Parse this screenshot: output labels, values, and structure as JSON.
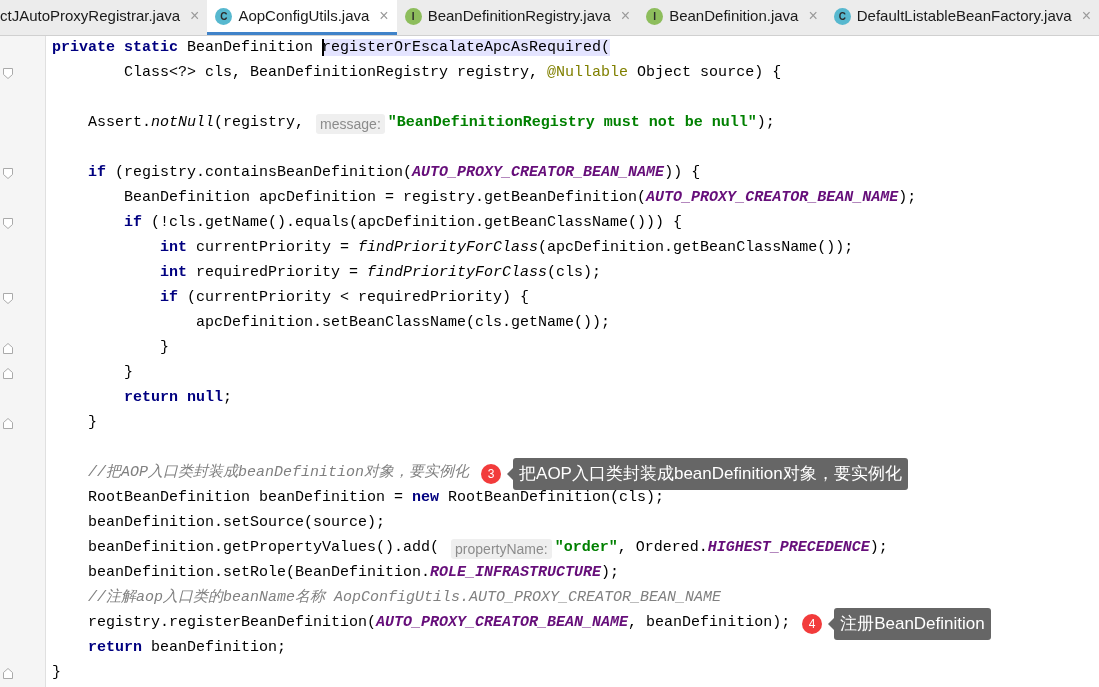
{
  "tabs": [
    {
      "label": "ctJAutoProxyRegistrar.java",
      "kind": "plain",
      "selected": false
    },
    {
      "label": "AopConfigUtils.java",
      "badge": "C",
      "kind": "class",
      "selected": true
    },
    {
      "label": "BeanDefinitionRegistry.java",
      "badge": "I",
      "kind": "interface",
      "selected": false
    },
    {
      "label": "BeanDefinition.java",
      "badge": "I",
      "kind": "interface",
      "selected": false
    },
    {
      "label": "DefaultListableBeanFactory.java",
      "badge": "C",
      "kind": "class",
      "selected": false
    }
  ],
  "close_glyph": "×",
  "code_lines": [
    {
      "kind": "code",
      "tokens": [
        {
          "kind": "keyword",
          "text": "private"
        },
        {
          "kind": "keyword",
          "text": " static"
        },
        {
          "kind": "plain",
          "text": " BeanDefinition "
        },
        {
          "kind": "selection",
          "text": "registerOrEscalateApcAsRequired("
        }
      ]
    },
    {
      "kind": "fold_start",
      "tokens": [
        {
          "kind": "plain",
          "text": "        Class<?> cls, BeanDefinitionRegistry registry, "
        },
        {
          "kind": "annotation",
          "text": "@Nullable"
        },
        {
          "kind": "plain",
          "text": " Object source) {"
        }
      ]
    },
    {
      "kind": "blank"
    },
    {
      "kind": "code",
      "tokens": [
        {
          "kind": "plain",
          "text": "    Assert."
        },
        {
          "kind": "italic",
          "text": "notNull"
        },
        {
          "kind": "plain",
          "text": "(registry, "
        },
        {
          "kind": "hint",
          "text": "message:"
        },
        {
          "kind": "string",
          "text": "\"BeanDefinitionRegistry must not be null\""
        },
        {
          "kind": "plain",
          "text": ");"
        }
      ]
    },
    {
      "kind": "blank"
    },
    {
      "kind": "fold_start",
      "tokens": [
        {
          "kind": "keyword",
          "text": "    if"
        },
        {
          "kind": "plain",
          "text": " (registry.containsBeanDefinition("
        },
        {
          "kind": "constant",
          "text": "AUTO_PROXY_CREATOR_BEAN_NAME"
        },
        {
          "kind": "plain",
          "text": ")) {"
        }
      ]
    },
    {
      "kind": "code",
      "tokens": [
        {
          "kind": "plain",
          "text": "        BeanDefinition apcDefinition = registry.getBeanDefinition("
        },
        {
          "kind": "constant",
          "text": "AUTO_PROXY_CREATOR_BEAN_NAME"
        },
        {
          "kind": "plain",
          "text": ");"
        }
      ]
    },
    {
      "kind": "fold_start",
      "tokens": [
        {
          "kind": "keyword",
          "text": "        if"
        },
        {
          "kind": "plain",
          "text": " (!cls.getName().equals(apcDefinition.getBeanClassName())) {"
        }
      ]
    },
    {
      "kind": "code",
      "tokens": [
        {
          "kind": "keyword",
          "text": "            int"
        },
        {
          "kind": "plain",
          "text": " currentPriority = "
        },
        {
          "kind": "italic",
          "text": "findPriorityForClass"
        },
        {
          "kind": "plain",
          "text": "(apcDefinition.getBeanClassName());"
        }
      ]
    },
    {
      "kind": "code",
      "tokens": [
        {
          "kind": "keyword",
          "text": "            int"
        },
        {
          "kind": "plain",
          "text": " requiredPriority = "
        },
        {
          "kind": "italic",
          "text": "findPriorityForClass"
        },
        {
          "kind": "plain",
          "text": "(cls);"
        }
      ]
    },
    {
      "kind": "fold_start",
      "tokens": [
        {
          "kind": "keyword",
          "text": "            if"
        },
        {
          "kind": "plain",
          "text": " (currentPriority < requiredPriority) {"
        }
      ]
    },
    {
      "kind": "code",
      "tokens": [
        {
          "kind": "plain",
          "text": "                apcDefinition.setBeanClassName(cls.getName());"
        }
      ]
    },
    {
      "kind": "fold_end",
      "tokens": [
        {
          "kind": "plain",
          "text": "            }"
        }
      ]
    },
    {
      "kind": "fold_end",
      "tokens": [
        {
          "kind": "plain",
          "text": "        }"
        }
      ]
    },
    {
      "kind": "code",
      "tokens": [
        {
          "kind": "keyword",
          "text": "        return"
        },
        {
          "kind": "keyword",
          "text": " null"
        },
        {
          "kind": "plain",
          "text": ";"
        }
      ]
    },
    {
      "kind": "fold_end",
      "tokens": [
        {
          "kind": "plain",
          "text": "    }"
        }
      ]
    },
    {
      "kind": "blank"
    },
    {
      "kind": "code",
      "tokens": [
        {
          "kind": "comment",
          "text": "    //把AOP入口类封装成beanDefinition对象，要实例化"
        }
      ],
      "callout": {
        "number": "3",
        "text": "把AOP入口类封装成beanDefinition对象，要实例化"
      }
    },
    {
      "kind": "code",
      "tokens": [
        {
          "kind": "plain",
          "text": "    RootBeanDefinition beanDefinition = "
        },
        {
          "kind": "keyword",
          "text": "new"
        },
        {
          "kind": "plain",
          "text": " RootBeanDefinition(cls);"
        }
      ]
    },
    {
      "kind": "code",
      "tokens": [
        {
          "kind": "plain",
          "text": "    beanDefinition.setSource(source);"
        }
      ]
    },
    {
      "kind": "code",
      "tokens": [
        {
          "kind": "plain",
          "text": "    beanDefinition.getPropertyValues().add( "
        },
        {
          "kind": "hint",
          "text": "propertyName:"
        },
        {
          "kind": "string",
          "text": "\"order\""
        },
        {
          "kind": "plain",
          "text": ", Ordered."
        },
        {
          "kind": "constant",
          "text": "HIGHEST_PRECEDENCE"
        },
        {
          "kind": "plain",
          "text": ");"
        }
      ]
    },
    {
      "kind": "code",
      "tokens": [
        {
          "kind": "plain",
          "text": "    beanDefinition.setRole(BeanDefinition."
        },
        {
          "kind": "constant",
          "text": "ROLE_INFRASTRUCTURE"
        },
        {
          "kind": "plain",
          "text": ");"
        }
      ]
    },
    {
      "kind": "code",
      "tokens": [
        {
          "kind": "comment",
          "text": "    //注解aop入口类的beanName名称 AopConfigUtils.AUTO_PROXY_CREATOR_BEAN_NAME"
        }
      ]
    },
    {
      "kind": "code",
      "tokens": [
        {
          "kind": "plain",
          "text": "    registry.registerBeanDefinition("
        },
        {
          "kind": "constant",
          "text": "AUTO_PROXY_CREATOR_BEAN_NAME"
        },
        {
          "kind": "plain",
          "text": ", beanDefinition);"
        }
      ],
      "callout": {
        "number": "4",
        "text": "注册BeanDefinition"
      }
    },
    {
      "kind": "code",
      "tokens": [
        {
          "kind": "keyword",
          "text": "    return"
        },
        {
          "kind": "plain",
          "text": " beanDefinition;"
        }
      ]
    },
    {
      "kind": "fold_end",
      "tokens": [
        {
          "kind": "plain",
          "text": "}"
        }
      ]
    }
  ]
}
